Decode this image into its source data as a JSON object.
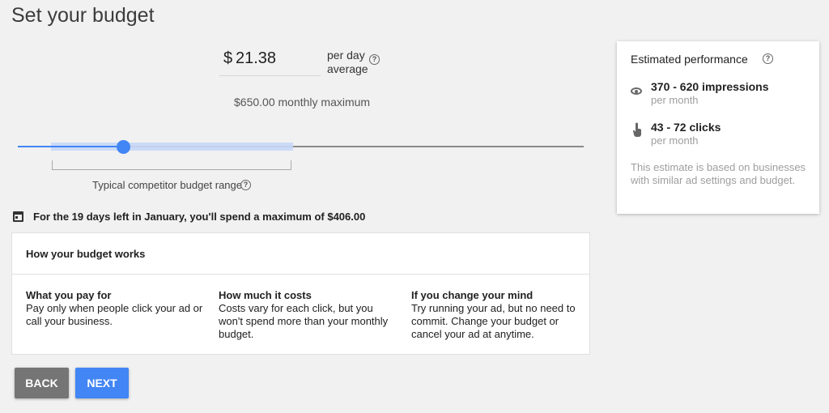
{
  "page": {
    "title": "Set your budget"
  },
  "budget": {
    "currency": "$",
    "amount": "21.38",
    "unit_line1": "per day",
    "unit_line2": "average",
    "monthly_max": "$650.00 monthly maximum"
  },
  "slider": {
    "value_fraction": 0.186,
    "range_start_fraction": 0.059,
    "range_end_fraction": 0.486,
    "range_label": "Typical competitor budget range"
  },
  "notice": {
    "text": "For the 19 days left in January, you'll spend a maximum of $406.00"
  },
  "how_it_works": {
    "title": "How your budget works",
    "columns": [
      {
        "title": "What you pay for",
        "body": "Pay only when people click your ad or call your business."
      },
      {
        "title": "How much it costs",
        "body": "Costs vary for each click, but you won't spend more than your monthly budget."
      },
      {
        "title": "If you change your mind",
        "body": "Try running your ad, but no need to commit. Change your budget or cancel your ad at anytime."
      }
    ]
  },
  "buttons": {
    "back": "BACK",
    "next": "NEXT"
  },
  "performance": {
    "title": "Estimated performance",
    "impressions": "370 - 620 impressions",
    "impressions_sub": "per month",
    "clicks": "43 - 72 clicks",
    "clicks_sub": "per month",
    "note": "This estimate is based on businesses with similar ad settings and budget."
  },
  "colors": {
    "accent": "#4285f4",
    "back_button": "#757575",
    "background": "#f1f1f1"
  },
  "icons": [
    "help-icon",
    "calendar-icon",
    "eye-icon",
    "click-icon"
  ]
}
